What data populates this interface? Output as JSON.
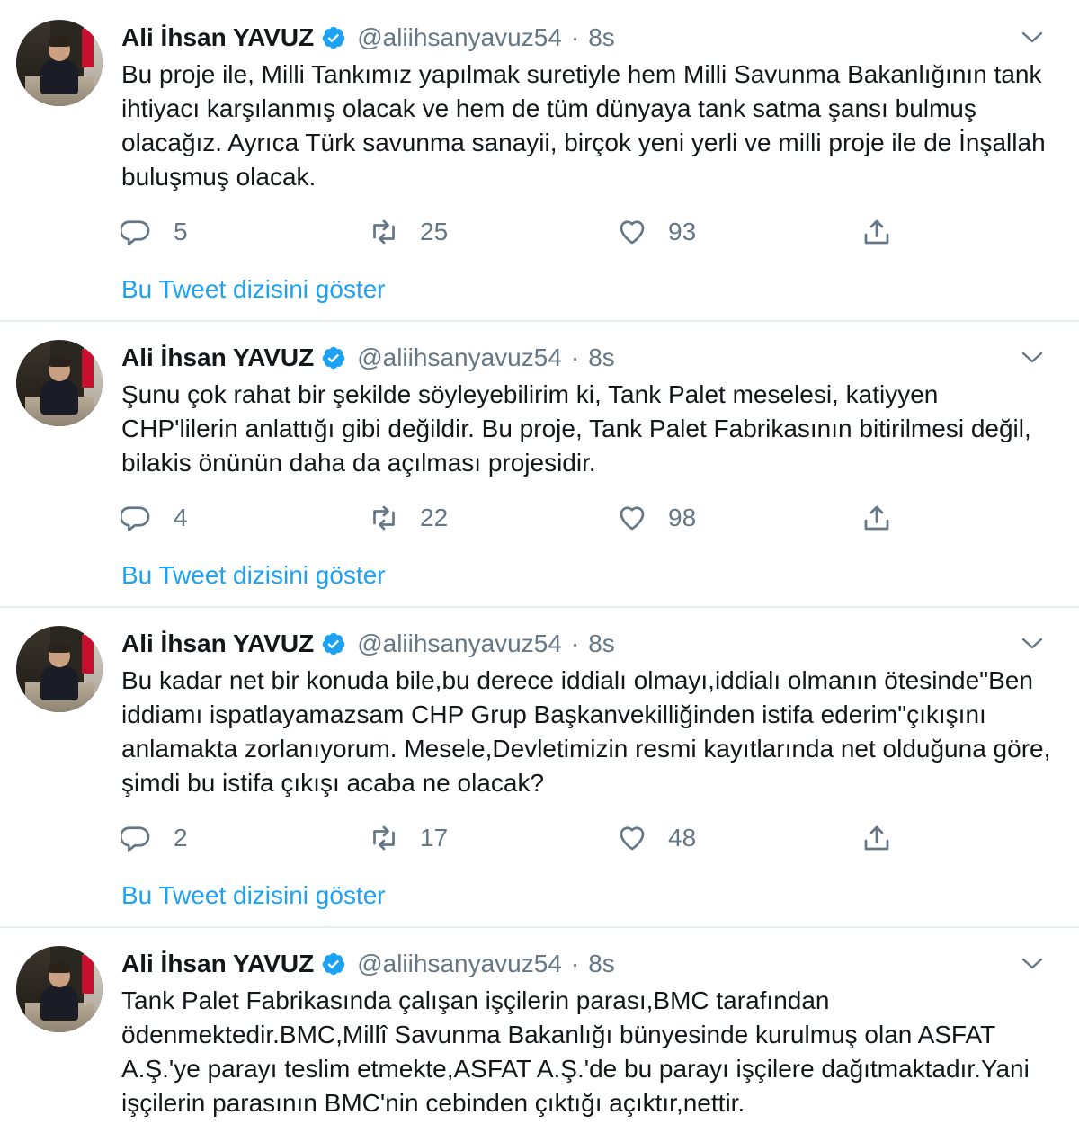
{
  "tweets": [
    {
      "author_name": "Ali İhsan YAVUZ",
      "handle": "@aliihsanyavuz54",
      "separator": "·",
      "time": "8s",
      "text": "Bu proje ile, Milli Tankımız yapılmak suretiyle hem Milli Savunma Bakanlığının tank ihtiyacı karşılanmış olacak ve hem de tüm dünyaya tank satma şansı bulmuş olacağız. Ayrıca Türk savunma sanayii, birçok yeni yerli ve milli proje ile de İnşallah buluşmuş olacak.",
      "replies": "5",
      "retweets": "25",
      "likes": "93",
      "thread_link": "Bu Tweet dizisini göster"
    },
    {
      "author_name": "Ali İhsan YAVUZ",
      "handle": "@aliihsanyavuz54",
      "separator": "·",
      "time": "8s",
      "text": "Şunu çok rahat bir şekilde söyleyebilirim ki, Tank Palet meselesi, katiyyen CHP'lilerin anlattığı gibi değildir. Bu proje, Tank Palet Fabrikasının bitirilmesi değil, bilakis önünün daha da açılması projesidir.",
      "replies": "4",
      "retweets": "22",
      "likes": "98",
      "thread_link": "Bu Tweet dizisini göster"
    },
    {
      "author_name": "Ali İhsan YAVUZ",
      "handle": "@aliihsanyavuz54",
      "separator": "·",
      "time": "8s",
      "text": "Bu kadar net bir konuda bile,bu derece iddialı olmayı,iddialı olmanın ötesinde\"Ben iddiamı ispatlayamazsam CHP Grup Başkanvekilliğinden istifa ederim\"çıkışını anlamakta zorlanıyorum. Mesele,Devletimizin resmi kayıtlarında net olduğuna göre, şimdi bu istifa çıkışı acaba ne olacak?",
      "replies": "2",
      "retweets": "17",
      "likes": "48",
      "thread_link": "Bu Tweet dizisini göster"
    },
    {
      "author_name": "Ali İhsan YAVUZ",
      "handle": "@aliihsanyavuz54",
      "separator": "·",
      "time": "8s",
      "text": "Tank Palet Fabrikasında çalışan işçilerin parası,BMC tarafından ödenmektedir.BMC,Millî Savunma Bakanlığı bünyesinde kurulmuş olan ASFAT A.Ş.'ye parayı teslim etmekte,ASFAT A.Ş.'de bu parayı işçilere dağıtmaktadır.Yani işçilerin parasının BMC'nin cebinden çıktığı açıktır,nettir."
    }
  ],
  "icons": {
    "verified": "verified-badge-icon",
    "caret": "chevron-down-icon",
    "reply": "reply-icon",
    "retweet": "retweet-icon",
    "like": "heart-icon",
    "share": "share-icon"
  },
  "colors": {
    "link": "#1da1f2",
    "secondary_text": "#657786",
    "primary_text": "#14171a",
    "divider": "#e6ecf0"
  }
}
